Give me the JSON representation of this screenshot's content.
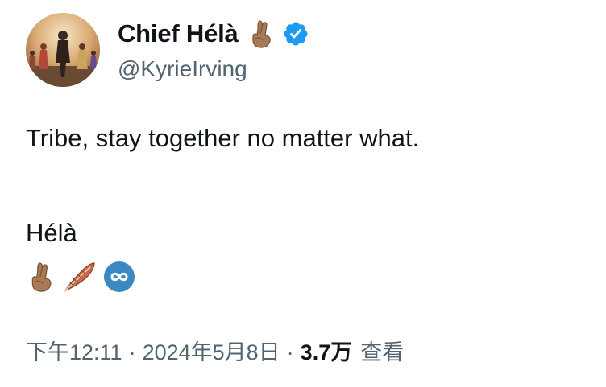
{
  "author": {
    "display_name": "Chief Hélà",
    "handle": "@KyrieIrving",
    "verified": true,
    "name_emoji": "crossed-fingers-icon"
  },
  "tweet": {
    "line1": "Tribe, stay together no matter what.",
    "line2": "Hélà",
    "emojis": [
      "crossed-fingers-icon",
      "feather-icon",
      "infinity-icon"
    ]
  },
  "meta": {
    "time": "下午12:11",
    "separator": "·",
    "date": "2024年5月8日",
    "views_count": "3.7万",
    "views_label": "查看"
  },
  "colors": {
    "text": "#0f1419",
    "secondary": "#536471",
    "verified_blue": "#1d9bf0",
    "infinity_blue": "#3b88c3"
  }
}
